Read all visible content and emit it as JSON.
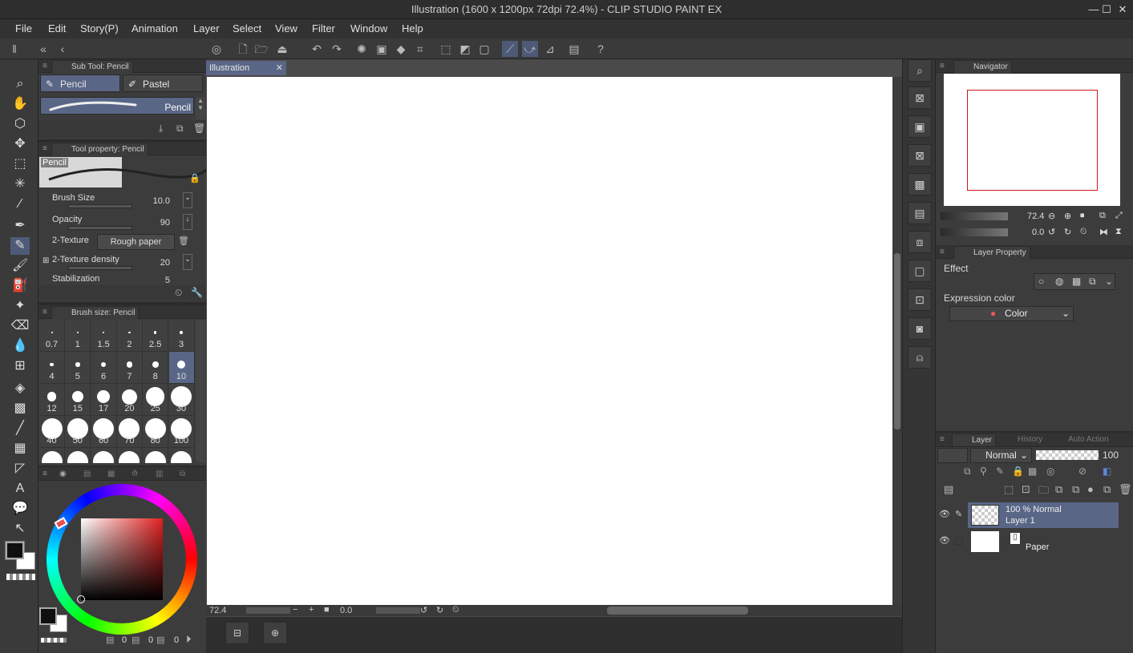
{
  "window": {
    "title": "Illustration (1600 x 1200px 72dpi 72.4%)  - CLIP STUDIO PAINT EX",
    "minimize": "—",
    "maximize": "☐",
    "close": "✕"
  },
  "menu": [
    "File",
    "Edit",
    "Story(P)",
    "Animation",
    "Layer",
    "Select",
    "View",
    "Filter",
    "Window",
    "Help"
  ],
  "sub_tool": {
    "header": "Sub Tool: Pencil",
    "tabs": [
      "Pencil",
      "Pastel"
    ],
    "preset_name": "Pencil"
  },
  "tool_property": {
    "header": "Tool property: Pencil",
    "preview_label": "Pencil",
    "brush_size": {
      "label": "Brush Size",
      "value": "10.0"
    },
    "opacity": {
      "label": "Opacity",
      "value": "90"
    },
    "texture": {
      "label": "2-Texture",
      "value": "Rough paper"
    },
    "texture_density": {
      "label": "2-Texture density",
      "value": "20"
    },
    "stabilization": {
      "label": "Stabilization",
      "value": "5"
    }
  },
  "brush_size_panel": {
    "header": "Brush size: Pencil",
    "sizes": [
      "0.7",
      "1",
      "1.5",
      "2",
      "2.5",
      "3",
      "4",
      "5",
      "6",
      "7",
      "8",
      "10",
      "12",
      "15",
      "17",
      "20",
      "25",
      "30",
      "40",
      "50",
      "60",
      "70",
      "80",
      "100"
    ],
    "selected": "10"
  },
  "color_panel": {
    "main_color": "#101010",
    "sub_color": "#ffffff",
    "hue_marker_color": "#e65050",
    "readouts": [
      "0",
      "0",
      "0"
    ]
  },
  "document": {
    "tab": "Illustration",
    "zoom": "72.4",
    "rotation": "0.0"
  },
  "navigator": {
    "header": "Navigator",
    "zoom": "72.4",
    "rotation": "0.0"
  },
  "layer_property": {
    "header": "Layer Property",
    "effect_label": "Effect",
    "expression_label": "Expression color",
    "expression_value": "Color"
  },
  "layer_panel": {
    "tabs": [
      "Layer",
      "History",
      "Auto Action"
    ],
    "blend_mode": "Normal",
    "opacity": "100",
    "layers": [
      {
        "line1": "100 % Normal",
        "line2": "Layer 1",
        "selected": true
      },
      {
        "line1": "",
        "line2": "Paper",
        "selected": false
      }
    ]
  }
}
